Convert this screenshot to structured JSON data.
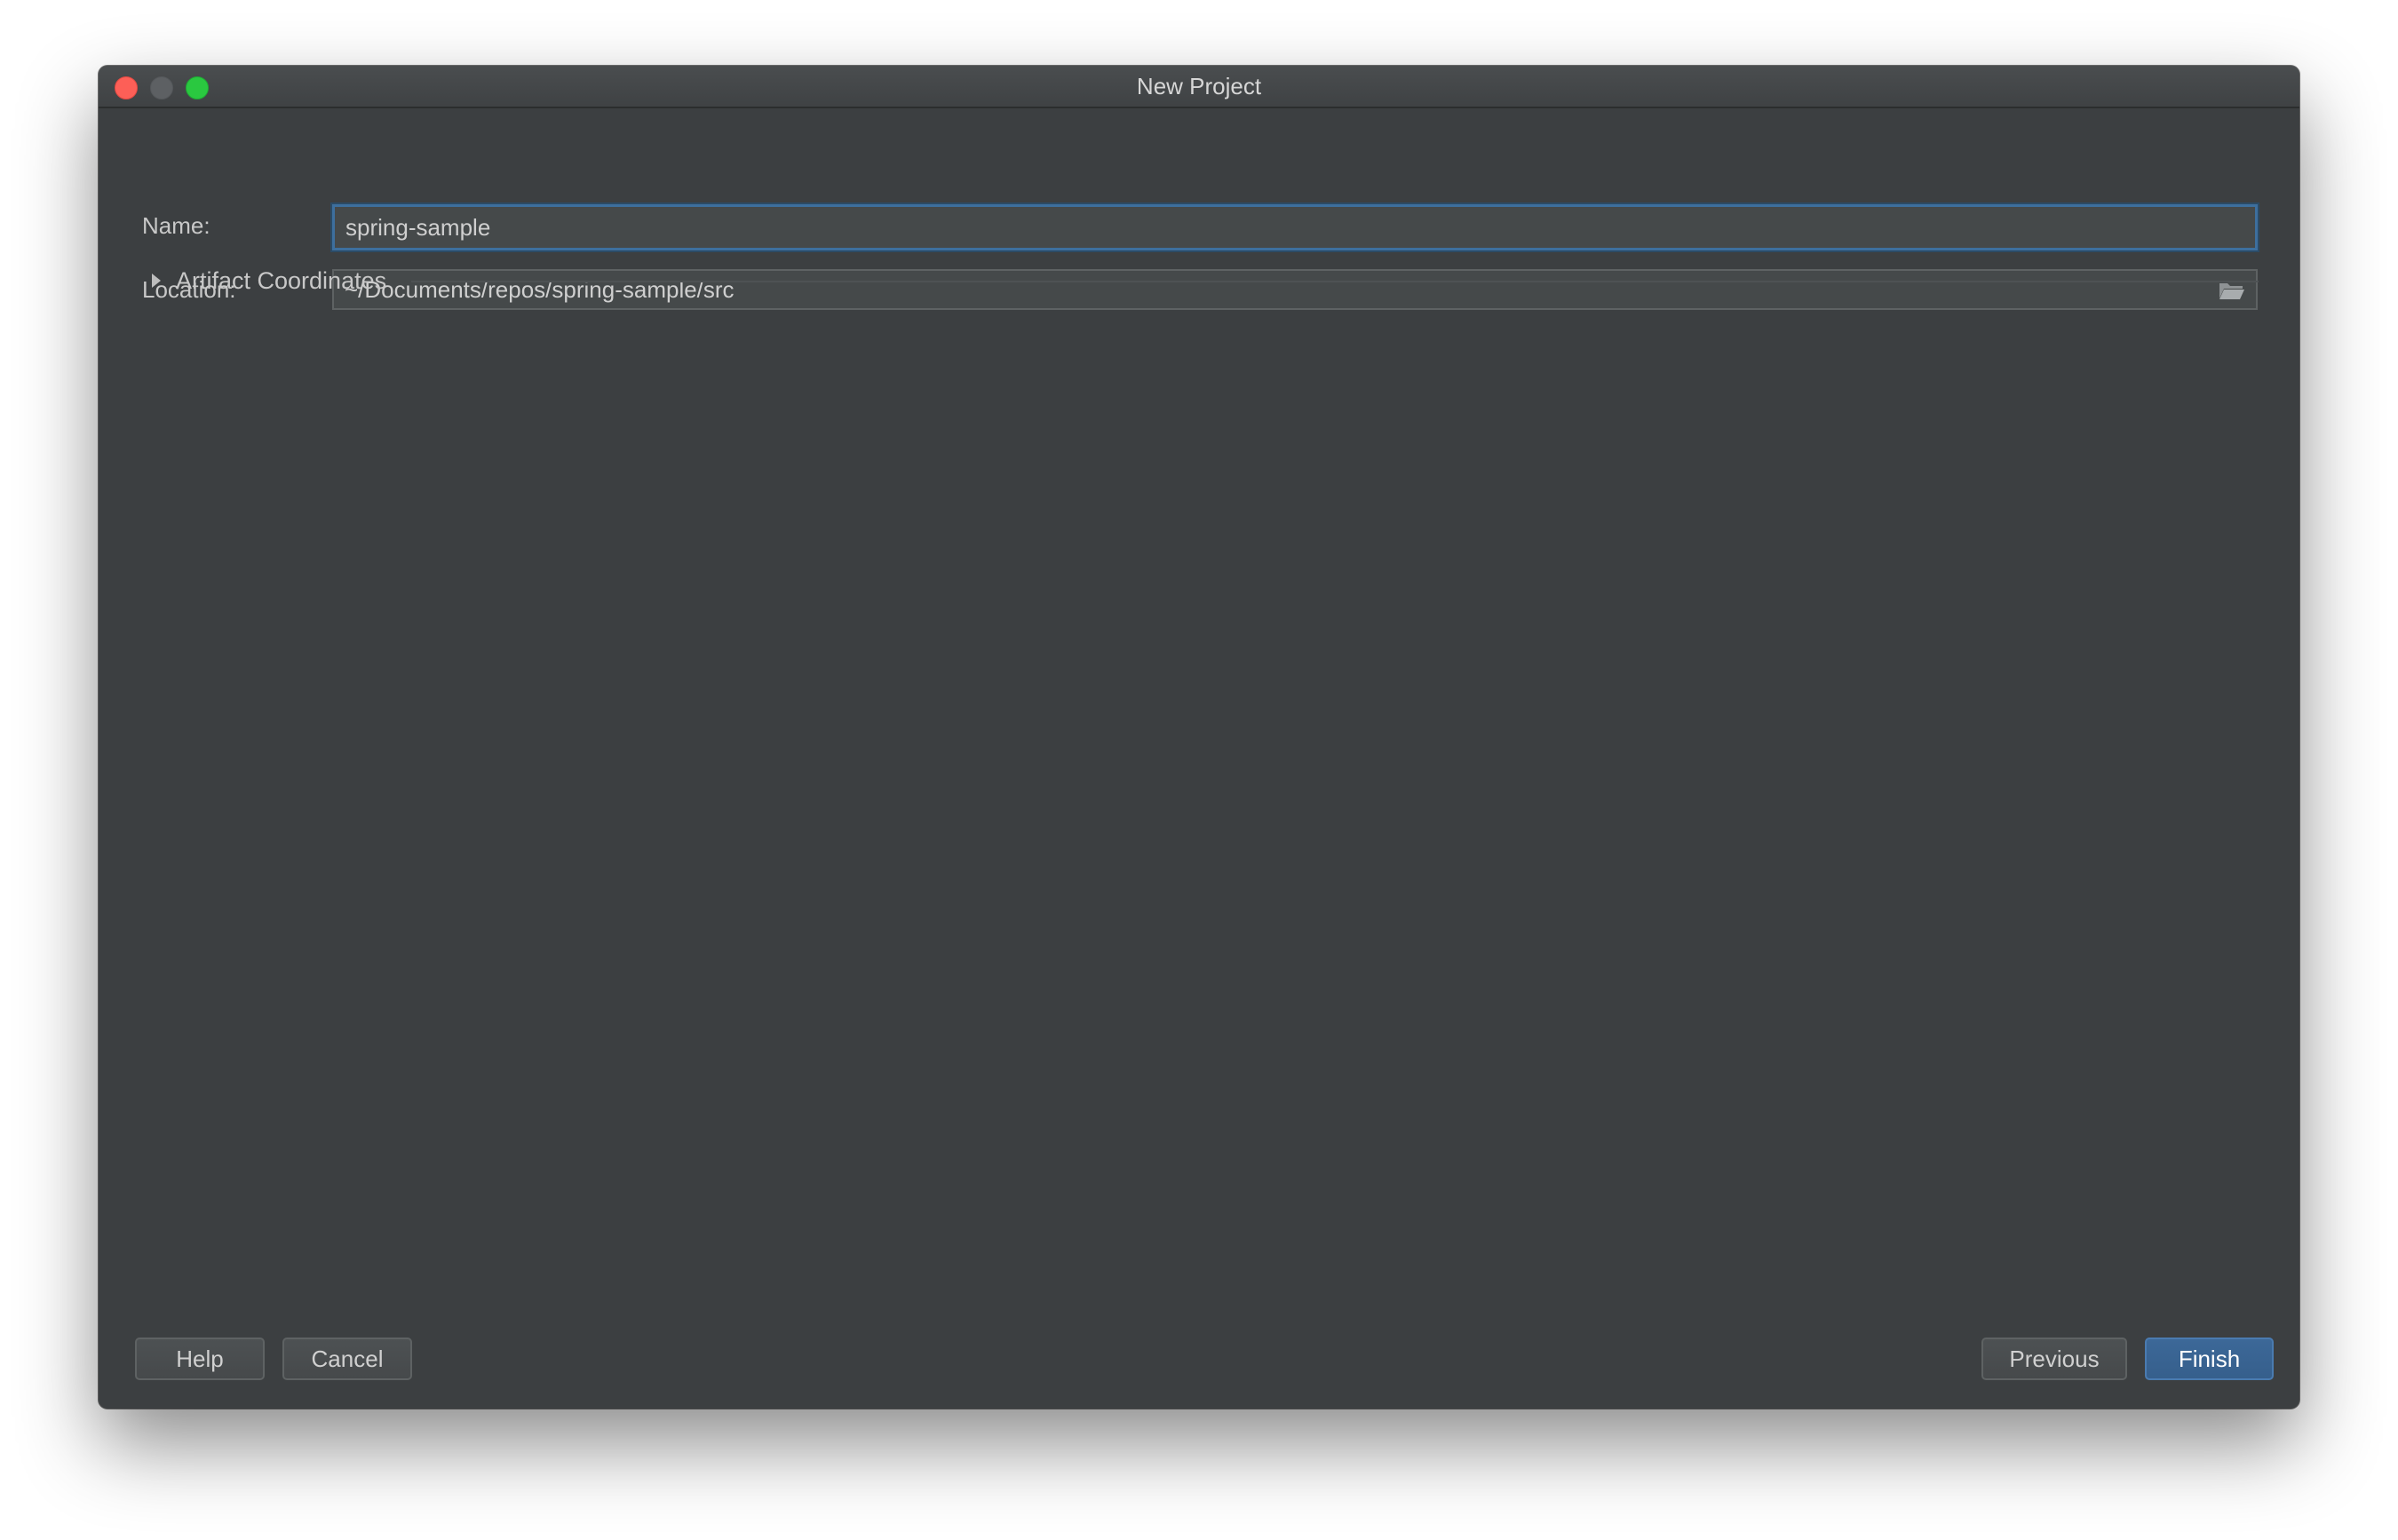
{
  "window": {
    "title": "New Project"
  },
  "form": {
    "name_label": "Name:",
    "name_value": "spring-sample",
    "location_label": "Location:",
    "location_value": "~/Documents/repos/spring-sample/src",
    "artifact_label": "Artifact Coordinates"
  },
  "buttons": {
    "help": "Help",
    "cancel": "Cancel",
    "previous": "Previous",
    "finish": "Finish"
  },
  "icons": {
    "folder": "folder-icon",
    "expand": "chevron-right-icon"
  },
  "colors": {
    "accent": "#3d6f9e",
    "background": "#3c3f41"
  }
}
